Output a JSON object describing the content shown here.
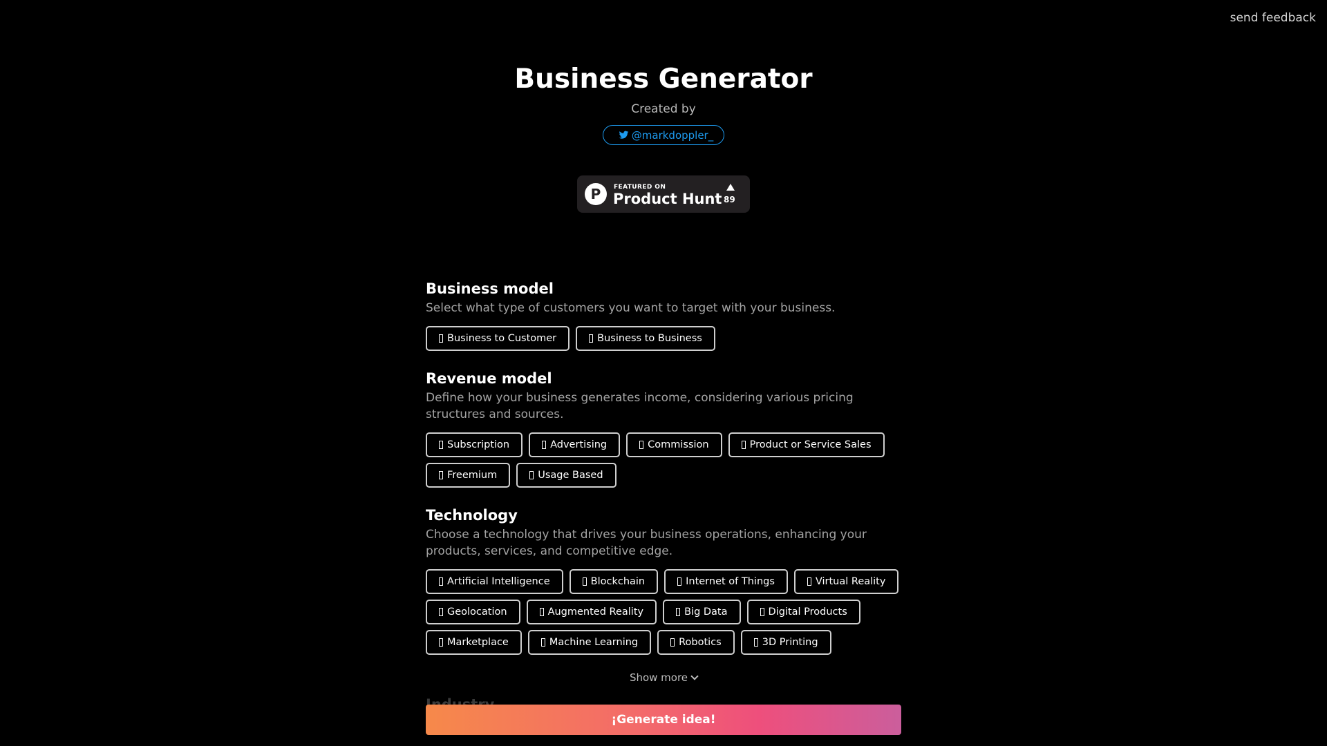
{
  "feedback_label": "send feedback",
  "header": {
    "title": "Business Generator",
    "created_by": "Created by",
    "twitter_handle": "@markdoppler_"
  },
  "product_hunt": {
    "featured": "FEATURED ON",
    "name": "Product Hunt",
    "count": "89"
  },
  "sections": {
    "business_model": {
      "title": "Business model",
      "description": "Select what type of customers you want to target with your business.",
      "options": [
        "Business to Customer",
        "Business to Business"
      ]
    },
    "revenue_model": {
      "title": "Revenue model",
      "description": "Define how your business generates income, considering various pricing structures and sources.",
      "options": [
        "Subscription",
        "Advertising",
        "Commission",
        "Product or Service Sales",
        "Freemium",
        "Usage Based"
      ]
    },
    "technology": {
      "title": "Technology",
      "description": "Choose a technology that drives your business operations, enhancing your products, services, and competitive edge.",
      "options": [
        "Artificial Intelligence",
        "Blockchain",
        "Internet of Things",
        "Virtual Reality",
        "Geolocation",
        "Augmented Reality",
        "Big Data",
        "Digital Products",
        "Marketplace",
        "Machine Learning",
        "Robotics",
        "3D Printing"
      ]
    }
  },
  "show_more": "Show more",
  "industry_title": "Industry",
  "generate_label": "¡Generate idea!",
  "colors": {
    "background": "#000000",
    "twitter": "#1d9bf0",
    "gradient_start": "#f6894a",
    "gradient_end": "#cb5e9c"
  }
}
